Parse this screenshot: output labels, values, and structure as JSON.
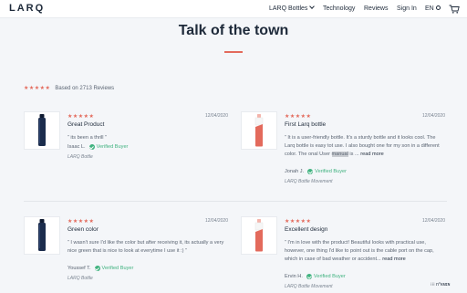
{
  "nav": {
    "logo": "LARQ",
    "links": [
      "LARQ Bottles",
      "Technology",
      "Reviews",
      "Sign In",
      "EN"
    ],
    "icons": [
      "chevron-down-icon",
      "globe-icon",
      "cart-icon"
    ]
  },
  "section": {
    "title": "Talk of the town"
  },
  "summary": {
    "stars": "★★★★★",
    "text": "Based on 2713 Reviews"
  },
  "reviews": [
    {
      "stars": "★★★★★",
      "date": "12/04/2020",
      "title": "Great Product",
      "body": "“ its been a thrill ”",
      "author": "Isaac L.",
      "verified": "Verified Buyer",
      "product": "LARQ Bottle"
    },
    {
      "stars": "★★★★★",
      "date": "12/04/2020",
      "title": "First Larq bottle",
      "body_a": "“ It is a user-friendly bottle. It's a sturdy bottle and it looks cool. The Larq bottle is easy tot use. I also bought one for my son in a different color. The onal User ",
      "body_hl": "manual",
      "body_b": " is ...",
      "more": "read more",
      "author": "Jonah J.",
      "verified": "Verified Buyer",
      "product": "LARQ Bottle Movement"
    },
    {
      "stars": "★★★★★",
      "date": "12/04/2020",
      "title": "Green color",
      "body": "“ I wasn't sure I'd like the color but after receiving it, its actually a very nice green that is nice to look at everytime I use it :) ”",
      "author": "Youssef T.",
      "verified": "Verified Buyer",
      "product": "LARQ Bottle"
    },
    {
      "stars": "★★★★★",
      "date": "12/04/2020",
      "title": "Excellent design",
      "body": "“ I'm in love with the product! Beautiful looks with practical use, however, one thing I'd like to point out is the cable port on the cap, which in case of bad weather or accident...",
      "more": "read more",
      "author": "Ervin H.",
      "verified": "Verified Buyer",
      "product": "LARQ Bottle Movement"
    }
  ],
  "watermark": "⁝⁝⁝ n°ᴋᴍɪɴ",
  "colors": {
    "accent": "#e36a5c",
    "verified": "#3fb27f",
    "text": "#1e2a3a",
    "bottle_navy": "#1b2c4c",
    "bottle_coral": "#e36a5c"
  }
}
